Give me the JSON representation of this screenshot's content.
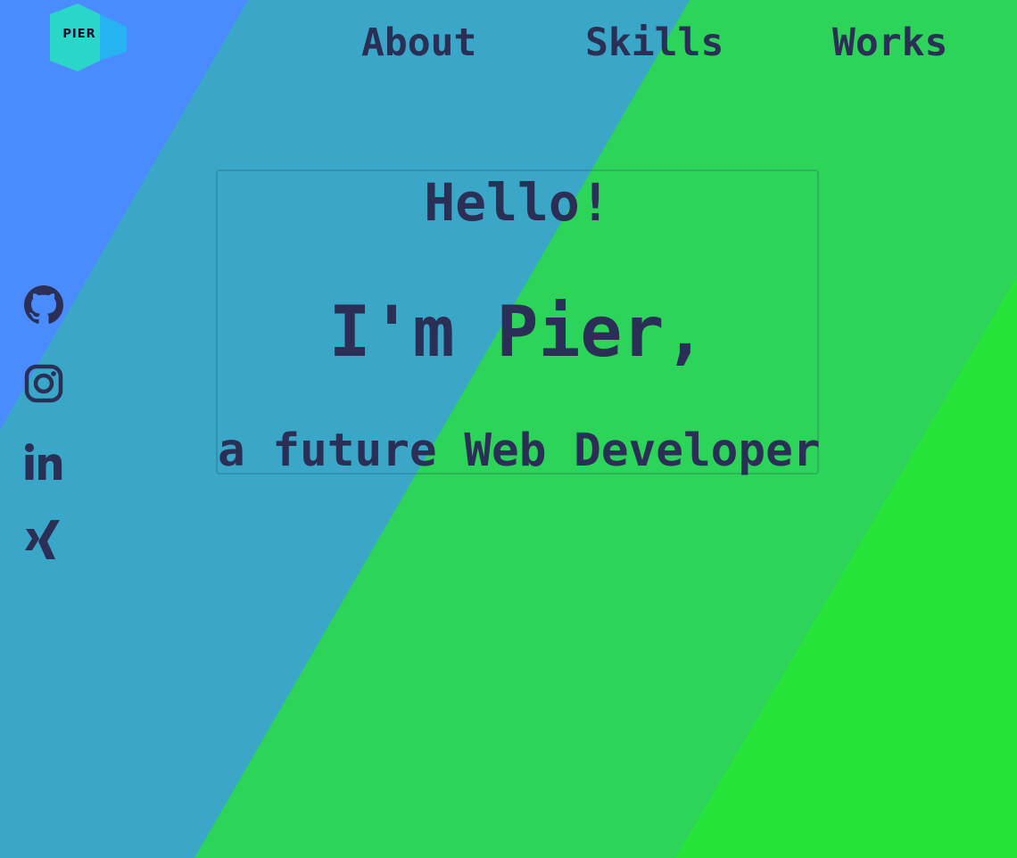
{
  "logo": {
    "text": "PIER"
  },
  "nav": {
    "about": "About",
    "skills": "Skills",
    "works": "Works"
  },
  "social": [
    {
      "icon": "github-icon"
    },
    {
      "icon": "instagram-icon"
    },
    {
      "icon": "linkedin-icon"
    },
    {
      "icon": "xing-icon"
    }
  ],
  "hero": {
    "greeting": "Hello!",
    "name": "I'm Pier,",
    "role": "a future Web Developer"
  },
  "colors": {
    "blue": "#4a8cff",
    "teal": "#3aa7c9",
    "green": "#2cd45a",
    "bright_green": "#27e43a",
    "text": "#2b2e55",
    "logo_cyan": "#2ad6c7",
    "logo_blue": "#27b2f2"
  }
}
